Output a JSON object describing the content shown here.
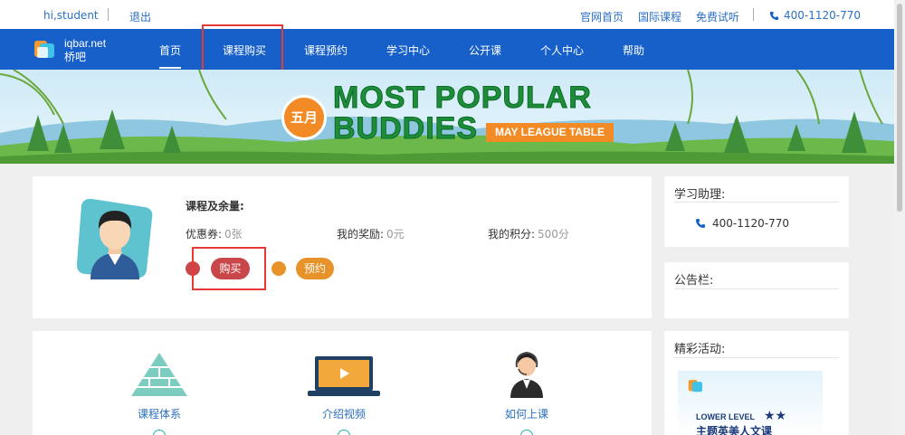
{
  "topbar": {
    "greeting": "hi,student",
    "logout": "退出",
    "links": [
      "官网首页",
      "国际课程",
      "免费试听"
    ],
    "phone": "400-1120-770"
  },
  "nav": {
    "logo_line1": "iqbar.net",
    "logo_line2": "桥吧",
    "items": [
      "首页",
      "课程购买",
      "课程预约",
      "学习中心",
      "公开课",
      "个人中心",
      "帮助"
    ]
  },
  "banner": {
    "badge": "五月",
    "line1": "MOST POPULAR",
    "line2": "BUDDIES",
    "tag": "MAY LEAGUE TABLE"
  },
  "profile": {
    "section_title": "课程及余量:",
    "coupon_label": "优惠券:",
    "coupon_value": "0张",
    "reward_label": "我的奖励:",
    "reward_value": "0元",
    "points_label": "我的积分:",
    "points_value": "500分",
    "buy_label": "购买",
    "book_label": "预约"
  },
  "sidebar": {
    "assistant_title": "学习助理:",
    "assistant_phone": "400-1120-770",
    "notice_title": "公告栏:",
    "activity_title": "精彩活动:",
    "promo_level": "LOWER LEVEL",
    "promo_text": "主题英美人文课"
  },
  "features": [
    {
      "label": "课程体系"
    },
    {
      "label": "介绍视频"
    },
    {
      "label": "如何上课"
    }
  ],
  "colors": {
    "nav": "#1760c9",
    "buy": "#c9474a",
    "book": "#e8922a",
    "link": "#2a6fc2"
  }
}
